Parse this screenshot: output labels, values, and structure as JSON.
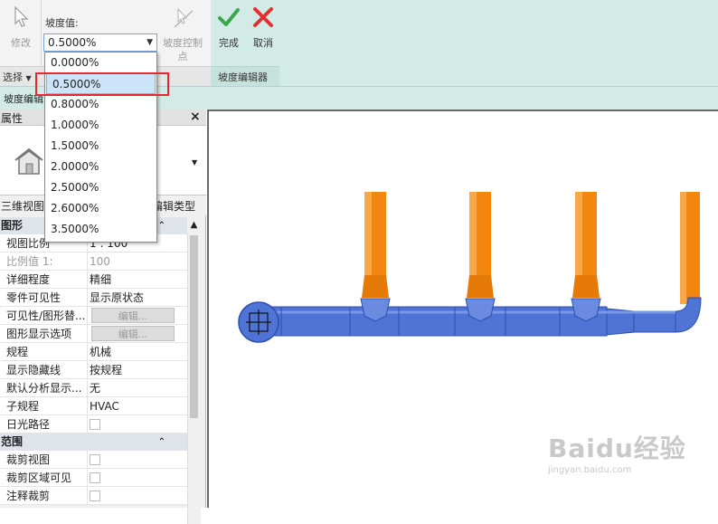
{
  "ribbon": {
    "modify_label": "修改",
    "slope_value_label": "坡度值:",
    "slope_current": "0.5000%",
    "slope_control_label_line1": "坡度控制",
    "slope_control_label_line2": "点",
    "finish_label": "完成",
    "cancel_label": "取消",
    "panel_select": "选择",
    "panel_slope_editor": "坡度编辑器"
  },
  "dropdown": {
    "options": [
      "0.0000%",
      "0.5000%",
      "0.8000%",
      "1.0000%",
      "1.5000%",
      "2.0000%",
      "2.5000%",
      "2.6000%",
      "3.5000%"
    ],
    "selected_index": 1
  },
  "subbar": {
    "label": "坡度编辑"
  },
  "properties": {
    "title": "属性",
    "close": "×",
    "view_type": "三维视图",
    "edit_type": "编辑类型",
    "sections": {
      "graphics": "图形",
      "extents": "范围"
    },
    "rows_graphics": [
      {
        "name": "视图比例",
        "value": "1 : 100"
      },
      {
        "name": "比例值 1:",
        "value": "100"
      },
      {
        "name": "详细程度",
        "value": "精细"
      },
      {
        "name": "零件可见性",
        "value": "显示原状态"
      },
      {
        "name": "可见性/图形替...",
        "value": "编辑..."
      },
      {
        "name": "图形显示选项",
        "value": "编辑..."
      },
      {
        "name": "规程",
        "value": "机械"
      },
      {
        "name": "显示隐藏线",
        "value": "按规程"
      },
      {
        "name": "默认分析显示...",
        "value": "无"
      },
      {
        "name": "子规程",
        "value": "HVAC"
      },
      {
        "name": "日光路径",
        "value": ""
      }
    ],
    "rows_extents": [
      {
        "name": "裁剪视图",
        "value": ""
      },
      {
        "name": "裁剪区域可见",
        "value": ""
      },
      {
        "name": "注释裁剪",
        "value": ""
      }
    ]
  },
  "watermark": {
    "brand": "Baidu经验",
    "url": "jingyan.baidu.com"
  },
  "colors": {
    "pipe_blue": "#4f74d6",
    "pipe_orange": "#f2860e",
    "ribbon_green": "#d2ebe6",
    "highlight_red": "#e8282c"
  }
}
